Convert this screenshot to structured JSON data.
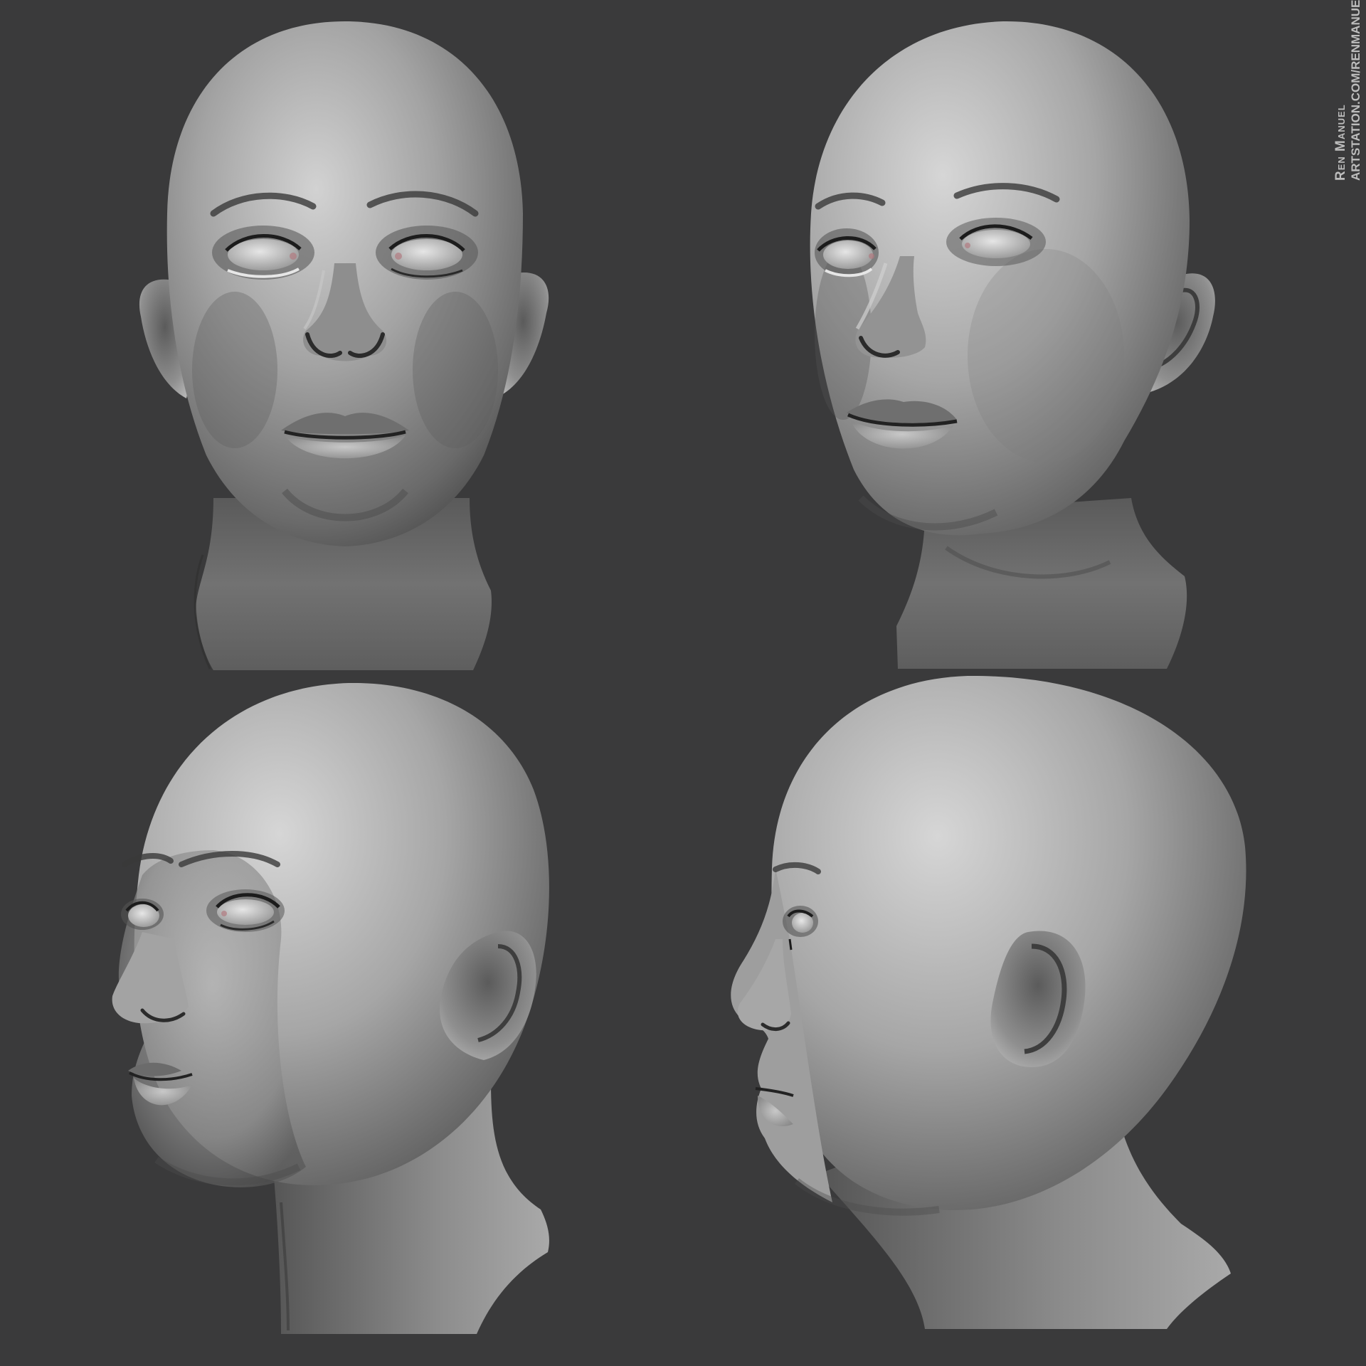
{
  "background_color": "#3a3a3b",
  "watermark": {
    "name": "Ren Manuel",
    "url": "ARTSTATION.COM/RENMANUEL"
  },
  "views": [
    {
      "icon": "head-front-view-icon"
    },
    {
      "icon": "head-three-quarter-right-view-icon"
    },
    {
      "icon": "head-three-quarter-left-view-icon"
    },
    {
      "icon": "head-profile-left-view-icon"
    }
  ],
  "colors": {
    "skin_light": "#cfcfcf",
    "skin_mid": "#9a9a9a",
    "skin_dark": "#4d4d4d",
    "eye_white": "#d9d9d9",
    "lash": "#1c1c1c",
    "eye_accent": "#b07a80"
  }
}
